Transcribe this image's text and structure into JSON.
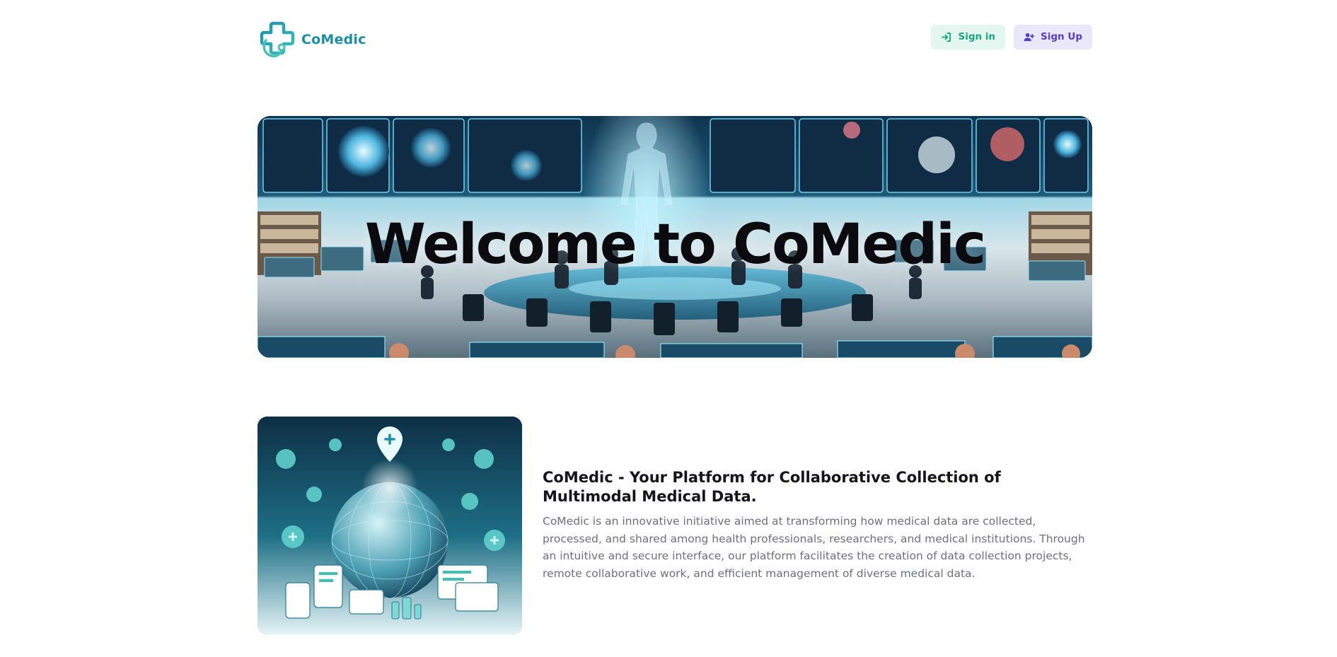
{
  "header": {
    "brand_name": "CoMedic",
    "signin_label": "Sign in",
    "signup_label": "Sign Up",
    "brand_color": "#1c8fa6"
  },
  "hero": {
    "title": "Welcome to CoMedic"
  },
  "about": {
    "title": "CoMedic - Your Platform for Collaborative Collection of Multimodal Medical Data.",
    "body": "CoMedic is an innovative initiative aimed at transforming how medical data are collected, processed, and shared among health professionals, researchers, and medical institutions. Through an intuitive and secure interface, our platform facilitates the creation of data collection projects, remote collaborative work, and efficient management of diverse medical data."
  },
  "colors": {
    "signin_bg": "#e3f7f0",
    "signin_fg": "#1ba77d",
    "signup_bg": "#ebe7fb",
    "signup_fg": "#5140c8"
  },
  "icons": {
    "logo": "medical-cross-stethoscope-logo",
    "signin": "sign-in-arrow-icon",
    "signup": "user-plus-icon"
  }
}
